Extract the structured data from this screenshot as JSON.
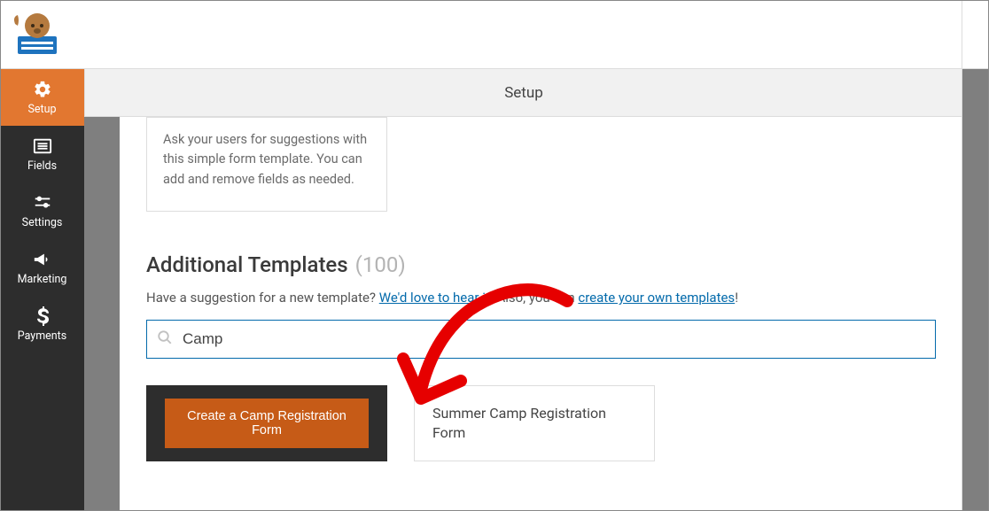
{
  "header": {
    "title": "Setup"
  },
  "sidebar": {
    "items": [
      {
        "label": "Setup"
      },
      {
        "label": "Fields"
      },
      {
        "label": "Settings"
      },
      {
        "label": "Marketing"
      },
      {
        "label": "Payments"
      }
    ]
  },
  "card": {
    "desc": "Ask your users for suggestions with this simple form template. You can add and remove fields as needed."
  },
  "section": {
    "title": "Additional Templates",
    "count": "(100)",
    "subtext_before": "Have a suggestion for a new template? ",
    "link1": "We'd love to hear it",
    "subtext_mid": ". Also, you can ",
    "link2": "create your own templates",
    "subtext_after": "!"
  },
  "search": {
    "value": "Camp",
    "placeholder": ""
  },
  "results": {
    "primary_btn": "Create a Camp Registration Form",
    "secondary": "Summer Camp Registration Form"
  }
}
